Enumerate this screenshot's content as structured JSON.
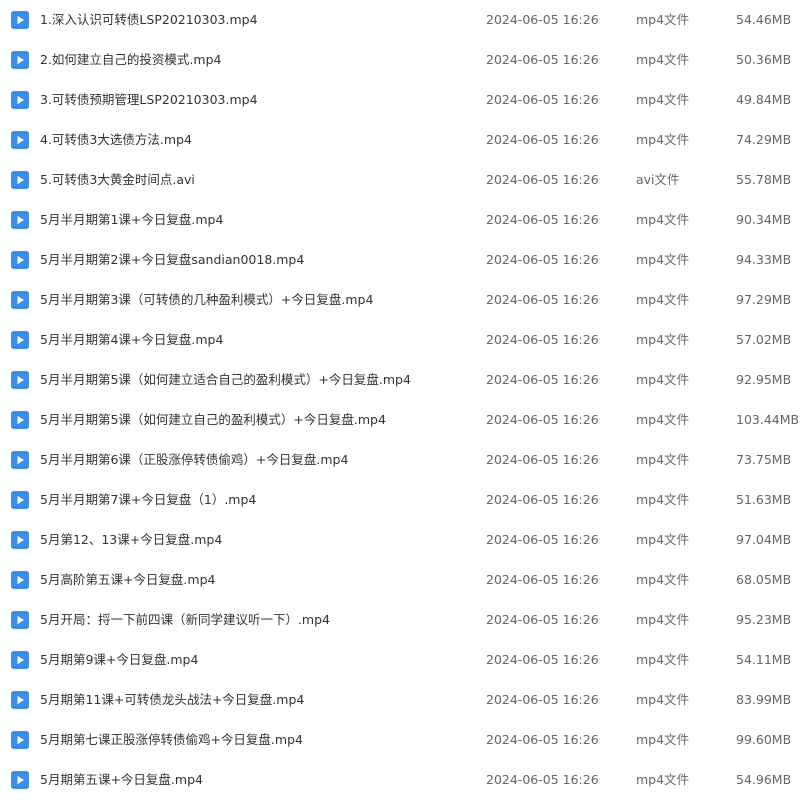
{
  "files": [
    {
      "name": "1.深入认识可转债LSP20210303.mp4",
      "date": "2024-06-05 16:26",
      "type": "mp4文件",
      "size": "54.46MB"
    },
    {
      "name": "2.如何建立自己的投资模式.mp4",
      "date": "2024-06-05 16:26",
      "type": "mp4文件",
      "size": "50.36MB"
    },
    {
      "name": "3.可转债预期管理LSP20210303.mp4",
      "date": "2024-06-05 16:26",
      "type": "mp4文件",
      "size": "49.84MB"
    },
    {
      "name": "4.可转债3大选债方法.mp4",
      "date": "2024-06-05 16:26",
      "type": "mp4文件",
      "size": "74.29MB"
    },
    {
      "name": "5.可转债3大黄金时间点.avi",
      "date": "2024-06-05 16:26",
      "type": "avi文件",
      "size": "55.78MB"
    },
    {
      "name": "5月半月期第1课+今日复盘.mp4",
      "date": "2024-06-05 16:26",
      "type": "mp4文件",
      "size": "90.34MB"
    },
    {
      "name": "5月半月期第2课+今日复盘sandian0018.mp4",
      "date": "2024-06-05 16:26",
      "type": "mp4文件",
      "size": "94.33MB"
    },
    {
      "name": "5月半月期第3课（可转债的几种盈利模式）+今日复盘.mp4",
      "date": "2024-06-05 16:26",
      "type": "mp4文件",
      "size": "97.29MB"
    },
    {
      "name": "5月半月期第4课+今日复盘.mp4",
      "date": "2024-06-05 16:26",
      "type": "mp4文件",
      "size": "57.02MB"
    },
    {
      "name": "5月半月期第5课（如何建立适合自己的盈利模式）+今日复盘.mp4",
      "date": "2024-06-05 16:26",
      "type": "mp4文件",
      "size": "92.95MB"
    },
    {
      "name": "5月半月期第5课（如何建立自己的盈利模式）+今日复盘.mp4",
      "date": "2024-06-05 16:26",
      "type": "mp4文件",
      "size": "103.44MB"
    },
    {
      "name": "5月半月期第6课（正股涨停转债偷鸡）+今日复盘.mp4",
      "date": "2024-06-05 16:26",
      "type": "mp4文件",
      "size": "73.75MB"
    },
    {
      "name": "5月半月期第7课+今日复盘（1）.mp4",
      "date": "2024-06-05 16:26",
      "type": "mp4文件",
      "size": "51.63MB"
    },
    {
      "name": "5月第12、13课+今日复盘.mp4",
      "date": "2024-06-05 16:26",
      "type": "mp4文件",
      "size": "97.04MB"
    },
    {
      "name": "5月高阶第五课+今日复盘.mp4",
      "date": "2024-06-05 16:26",
      "type": "mp4文件",
      "size": "68.05MB"
    },
    {
      "name": "5月开局：捋一下前四课（新同学建议听一下）.mp4",
      "date": "2024-06-05 16:26",
      "type": "mp4文件",
      "size": "95.23MB"
    },
    {
      "name": "5月期第9课+今日复盘.mp4",
      "date": "2024-06-05 16:26",
      "type": "mp4文件",
      "size": "54.11MB"
    },
    {
      "name": "5月期第11课+可转债龙头战法+今日复盘.mp4",
      "date": "2024-06-05 16:26",
      "type": "mp4文件",
      "size": "83.99MB"
    },
    {
      "name": "5月期第七课正股涨停转债偷鸡+今日复盘.mp4",
      "date": "2024-06-05 16:26",
      "type": "mp4文件",
      "size": "99.60MB"
    },
    {
      "name": "5月期第五课+今日复盘.mp4",
      "date": "2024-06-05 16:26",
      "type": "mp4文件",
      "size": "54.96MB"
    }
  ],
  "icon": "video-file-icon",
  "colors": {
    "icon": "#3a8ee6",
    "text": "#333333",
    "muted": "#666666"
  }
}
